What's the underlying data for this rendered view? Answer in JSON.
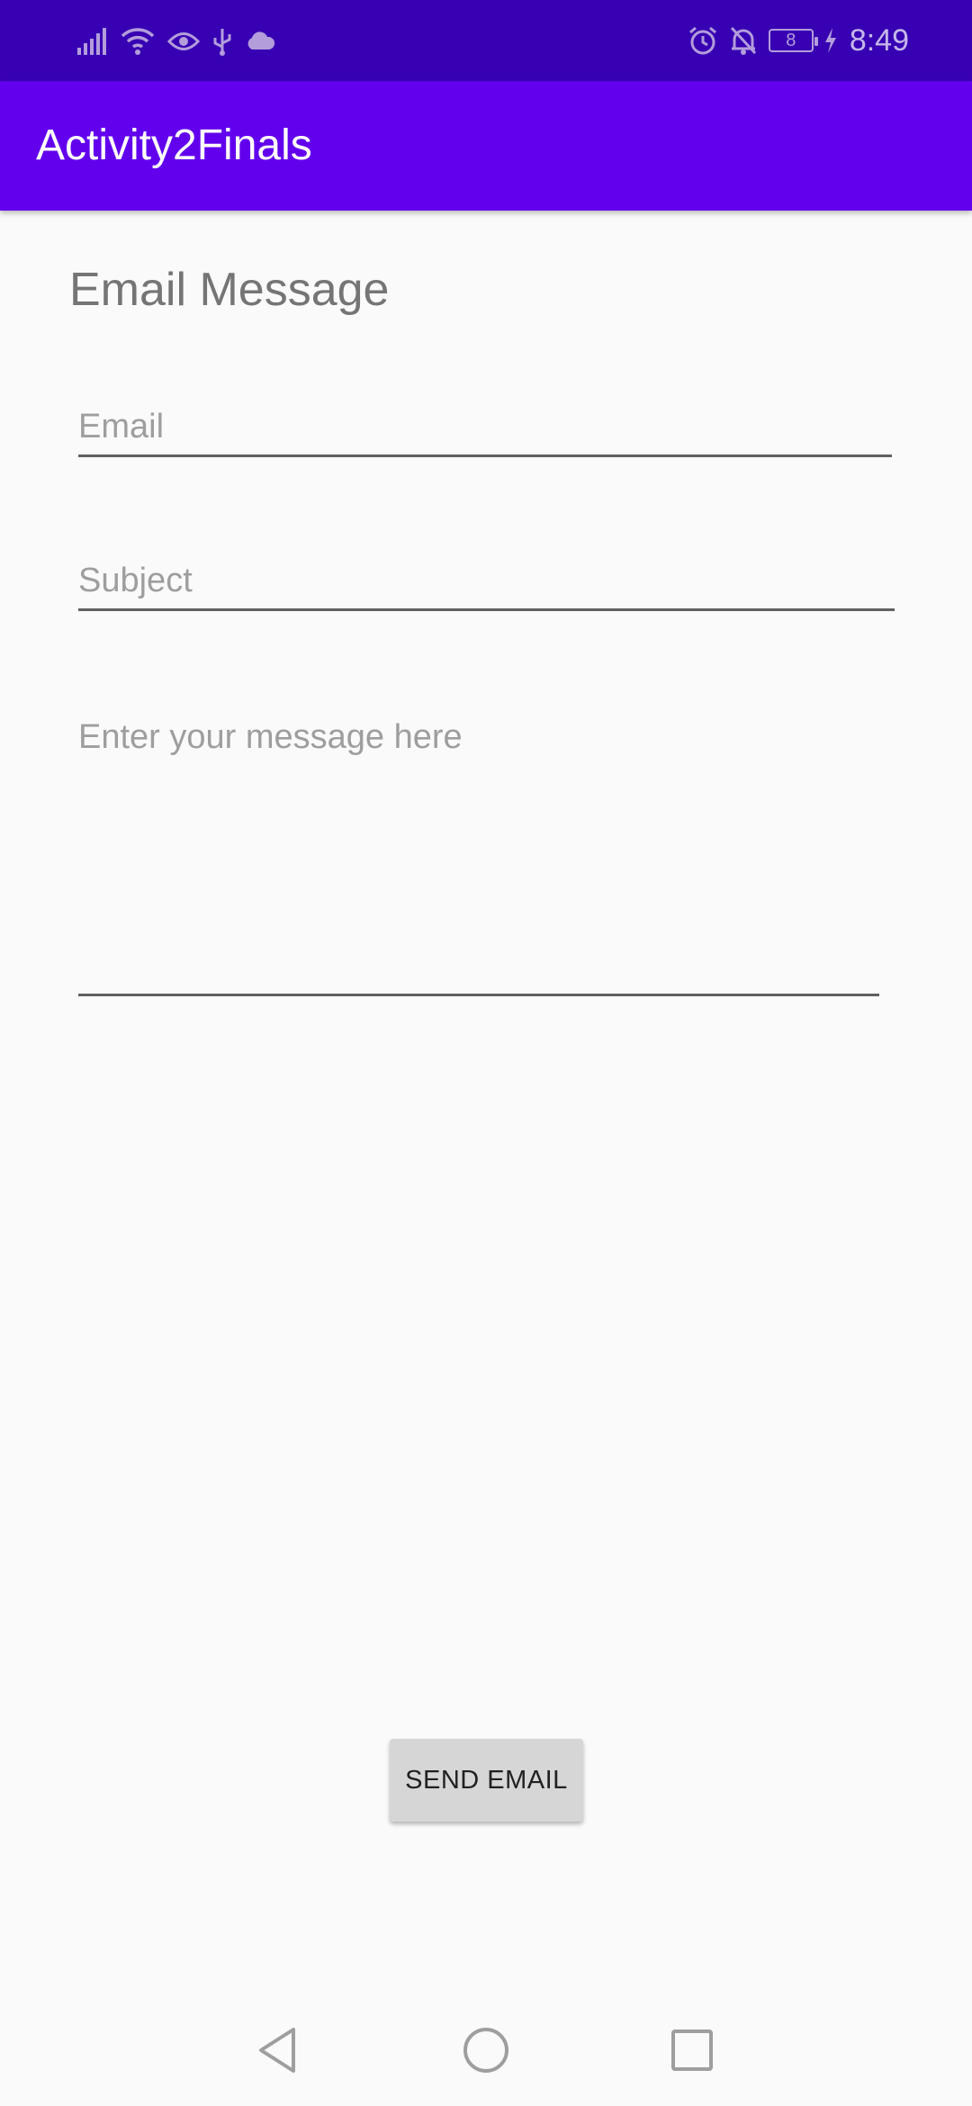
{
  "status_bar": {
    "time": "8:49",
    "battery_level": "8",
    "left_icons": [
      "signal-icon",
      "wifi-icon",
      "eye-icon",
      "usb-icon",
      "cloud-icon"
    ],
    "right_icons": [
      "alarm-icon",
      "notifications-off-icon",
      "battery-icon",
      "charging-icon"
    ],
    "background_color": "#3700b3"
  },
  "app_bar": {
    "title": "Activity2Finals",
    "color": "#6200ee"
  },
  "form": {
    "heading": "Email Message",
    "email": {
      "value": "",
      "placeholder": "Email"
    },
    "subject": {
      "value": "",
      "placeholder": "Subject"
    },
    "message": {
      "value": "",
      "placeholder": "Enter your message here"
    },
    "send_label": "SEND EMAIL"
  },
  "nav_bar": {
    "buttons": [
      "back-icon",
      "home-icon",
      "recents-icon"
    ]
  }
}
